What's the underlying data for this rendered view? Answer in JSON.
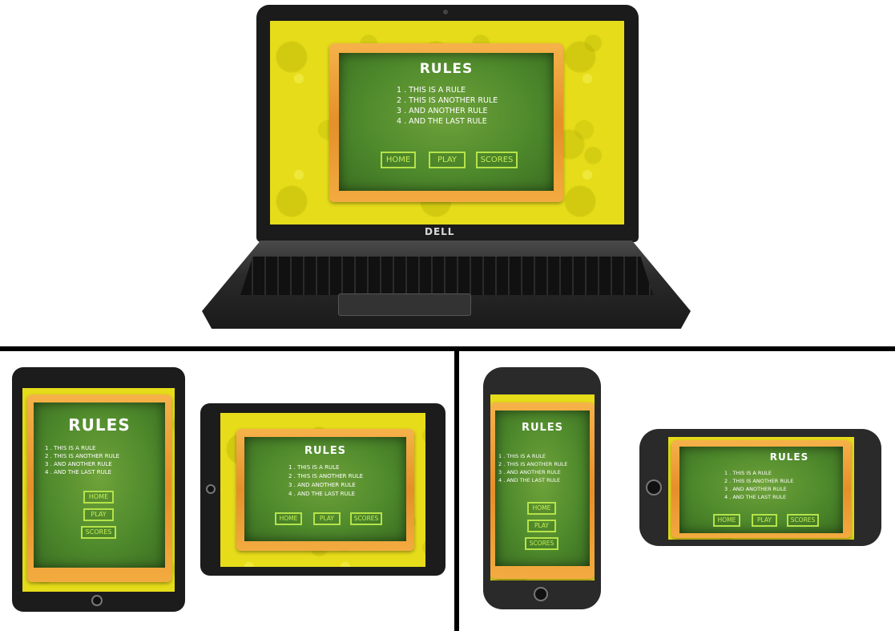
{
  "laptop": {
    "brand": "DELL"
  },
  "rules": {
    "title": "RULES",
    "items": [
      "1 . THIS IS A RULE",
      "2 . THIS IS ANOTHER RULE",
      "3 . AND ANOTHER RULE",
      "4 . AND THE LAST RULE"
    ]
  },
  "buttons": {
    "home": "HOME",
    "play": "PLAY",
    "scores": "SCORES"
  },
  "colors": {
    "background_yellow": "#e6dc1a",
    "frame_wood": "#e58f2a",
    "board_green": "#4f8a2c",
    "button_outline": "#b5e34a"
  }
}
